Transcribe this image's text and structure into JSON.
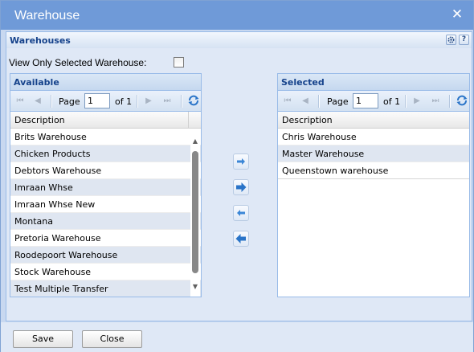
{
  "window": {
    "title": "Warehouse",
    "close_icon": "close-icon"
  },
  "panel": {
    "title": "Warehouses",
    "tools": [
      "gear-icon",
      "help-icon"
    ],
    "help_glyph": "?"
  },
  "filter": {
    "label": "View Only Selected Warehouse:",
    "checked": false
  },
  "available": {
    "title": "Available",
    "pager": {
      "page_label": "Page",
      "page_value": "1",
      "of_label": "of 1"
    },
    "column": "Description",
    "rows": [
      "Brits Warehouse",
      "Chicken Products",
      "Debtors Warehouse",
      "Imraan Whse",
      "Imraan Whse New",
      "Montana",
      "Pretoria Warehouse",
      "Roodepoort Warehouse",
      "Stock Warehouse",
      "Test Multiple Transfer"
    ]
  },
  "selected": {
    "title": "Selected",
    "pager": {
      "page_label": "Page",
      "page_value": "1",
      "of_label": "of 1"
    },
    "column": "Description",
    "rows": [
      "Chris Warehouse",
      "Master Warehouse",
      "Queenstown warehouse"
    ]
  },
  "move_buttons": [
    "move-right-icon",
    "move-all-right-icon",
    "move-left-icon",
    "move-all-left-icon"
  ],
  "footer": {
    "save_label": "Save",
    "close_label": "Close"
  },
  "colors": {
    "titlebar": "#6f9ad8",
    "header_text": "#15428b",
    "alt_row": "#dfe6f1",
    "background": "#dfe8f6"
  }
}
